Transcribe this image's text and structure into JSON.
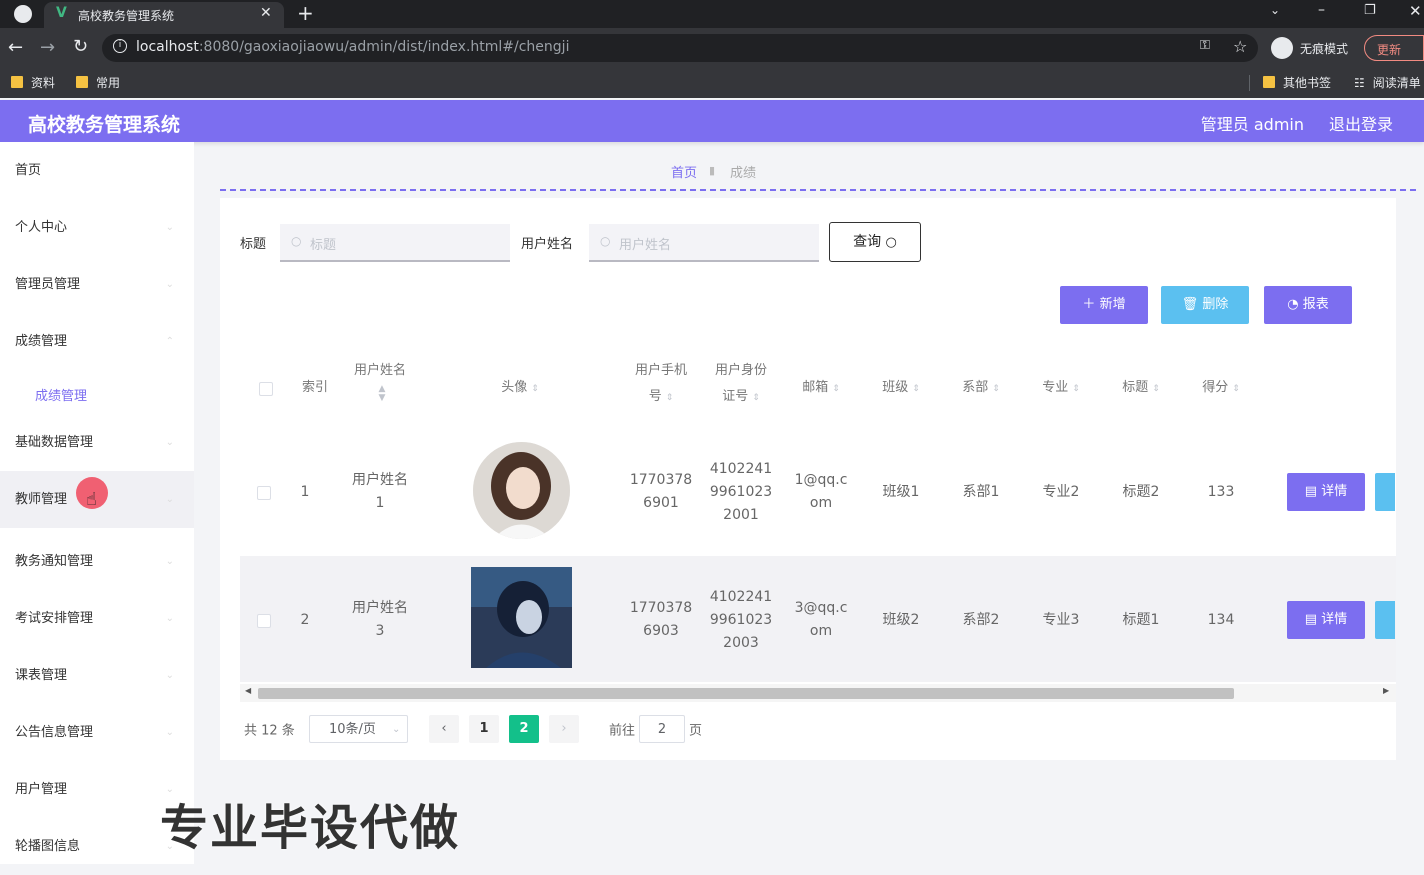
{
  "browser": {
    "tab_title": "高校教务管理系统",
    "url_host": "localhost",
    "url_path": ":8080/gaoxiaojiaowu/admin/dist/index.html#/chengji",
    "incognito": "无痕模式",
    "update": "更新",
    "bookmarks": [
      "资料",
      "常用"
    ],
    "bookmarks_right": [
      "其他书签",
      "阅读清单"
    ]
  },
  "header": {
    "title": "高校教务管理系统",
    "user": "管理员 admin",
    "logout": "退出登录"
  },
  "sidebar": {
    "items": [
      "首页",
      "个人中心",
      "管理员管理",
      "成绩管理",
      "基础数据管理",
      "教师管理",
      "教务通知管理",
      "考试安排管理",
      "课表管理",
      "公告信息管理",
      "用户管理",
      "轮播图信息"
    ],
    "sub_item": "成绩管理"
  },
  "breadcrumb": {
    "home": "首页",
    "current": "成绩"
  },
  "search": {
    "label1": "标题",
    "placeholder1": "标题",
    "label2": "用户姓名",
    "placeholder2": "用户姓名",
    "query": "查询"
  },
  "actions": {
    "add": "新增",
    "delete": "删除",
    "report": "报表"
  },
  "table": {
    "headers": {
      "index": "索引",
      "name": [
        "用户姓名"
      ],
      "avatar": "头像",
      "phone": [
        "用户手机",
        "号"
      ],
      "idcard": [
        "用户身份",
        "证号"
      ],
      "email": "邮箱",
      "class": "班级",
      "dept": "系部",
      "major": "专业",
      "title": "标题",
      "score": "得分"
    },
    "rows": [
      {
        "index": "1",
        "name": [
          "用户姓名",
          "1"
        ],
        "phone": [
          "1770378",
          "6901"
        ],
        "idcard": [
          "4102241",
          "9961023",
          "2001"
        ],
        "email": [
          "1@qq.c",
          "om"
        ],
        "class": "班级1",
        "dept": "系部1",
        "major": "专业2",
        "title": "标题2",
        "score": "133",
        "detail": "详情"
      },
      {
        "index": "2",
        "name": [
          "用户姓名",
          "3"
        ],
        "phone": [
          "1770378",
          "6903"
        ],
        "idcard": [
          "4102241",
          "9961023",
          "2003"
        ],
        "email": [
          "3@qq.c",
          "om"
        ],
        "class": "班级2",
        "dept": "系部2",
        "major": "专业3",
        "title": "标题1",
        "score": "134",
        "detail": "详情"
      }
    ]
  },
  "pagination": {
    "total": "共 12 条",
    "page_size": "10条/页",
    "pages": [
      "1",
      "2"
    ],
    "goto": "前往",
    "goto_value": "2",
    "page_unit": "页"
  },
  "watermark": "专业毕设代做",
  "colors": {
    "accent": "#7c6ef0",
    "info": "#5bc0f0",
    "page_active": "#13c08a"
  }
}
